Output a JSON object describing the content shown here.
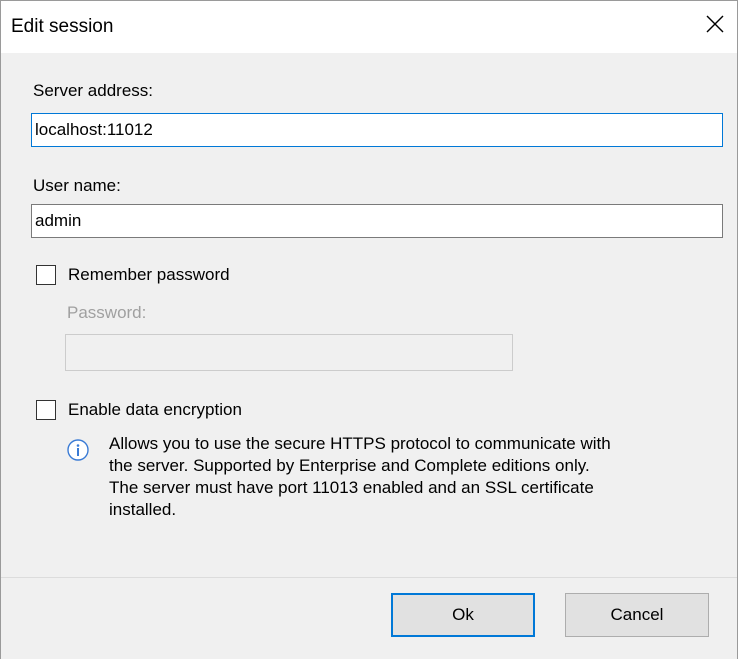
{
  "window": {
    "title": "Edit session"
  },
  "server_address": {
    "label": "Server address:",
    "value": "localhost:11012"
  },
  "user_name": {
    "label": "User name:",
    "value": "admin"
  },
  "remember_password": {
    "label": "Remember password",
    "checked": false
  },
  "password": {
    "label": "Password:",
    "value": "",
    "enabled": false
  },
  "encryption": {
    "label": "Enable data encryption",
    "checked": false
  },
  "info": {
    "icon": "info-icon",
    "lines": [
      "Allows you to use the secure HTTPS protocol to communicate with",
      "the server. Supported by Enterprise and Complete editions only.",
      "The server must have port 11013 enabled and an SSL certificate",
      "installed."
    ]
  },
  "buttons": {
    "ok": "Ok",
    "cancel": "Cancel"
  },
  "colors": {
    "accent": "#0078d7",
    "info_icon": "#3a7bd5",
    "disabled_text": "#a0a0a0"
  }
}
